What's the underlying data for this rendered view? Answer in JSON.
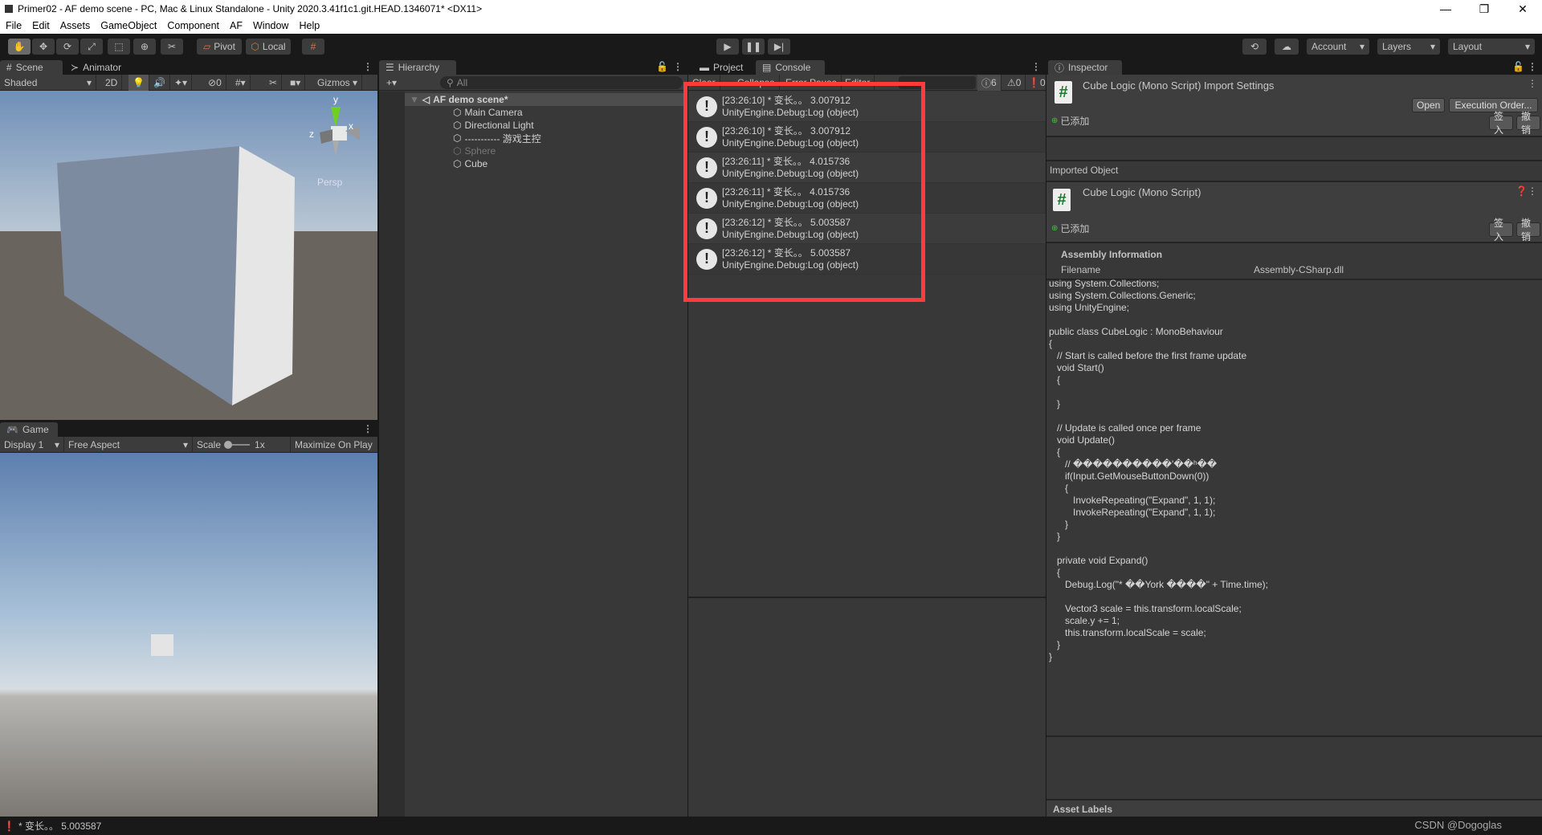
{
  "window": {
    "title": "Primer02 - AF demo scene - PC, Mac & Linux Standalone - Unity 2020.3.41f1c1.git.HEAD.1346071* <DX11>",
    "minimize": "—",
    "restore": "❐",
    "close": "✕"
  },
  "menu": [
    "File",
    "Edit",
    "Assets",
    "GameObject",
    "Component",
    "AF",
    "Window",
    "Help"
  ],
  "toolbar": {
    "tools": [
      "hand-tool",
      "move-tool",
      "rotate-tool",
      "scale-tool",
      "rect-tool",
      "transform-tool",
      "custom-tool"
    ],
    "pivot": "Pivot",
    "local": "Local",
    "account": "Account",
    "layers": "Layers",
    "layout": "Layout"
  },
  "scene": {
    "tabs": [
      "Scene",
      "Animator"
    ],
    "shading": "Shaded",
    "mode2d": "2D",
    "hidden_count": "0",
    "gizmos": "Gizmos",
    "persp": "Persp",
    "axes": {
      "x": "x",
      "y": "y",
      "z": "z"
    }
  },
  "game": {
    "tab": "Game",
    "display": "Display 1",
    "aspect": "Free Aspect",
    "scale_label": "Scale",
    "scale_value": "1x",
    "maximize": "Maximize On Play"
  },
  "hierarchy": {
    "tab": "Hierarchy",
    "search_placeholder": "All",
    "scene": "AF demo scene*",
    "items": [
      "Main Camera",
      "Directional Light",
      "----------- 游戏主控",
      "Sphere",
      "Cube"
    ]
  },
  "console": {
    "tabs": [
      "Project",
      "Console"
    ],
    "buttons": [
      "Clear",
      "Collapse",
      "Error Pause",
      "Editor"
    ],
    "counts": {
      "log": "6",
      "warn": "0",
      "error": "0"
    },
    "entries": [
      {
        "line1": "[23:26:10] * 变长。。 3.007912",
        "line2": "UnityEngine.Debug:Log (object)"
      },
      {
        "line1": "[23:26:10] * 变长。。 3.007912",
        "line2": "UnityEngine.Debug:Log (object)"
      },
      {
        "line1": "[23:26:11] * 变长。。 4.015736",
        "line2": "UnityEngine.Debug:Log (object)"
      },
      {
        "line1": "[23:26:11] * 变长。。 4.015736",
        "line2": "UnityEngine.Debug:Log (object)"
      },
      {
        "line1": "[23:26:12] * 变长。。 5.003587",
        "line2": "UnityEngine.Debug:Log (object)"
      },
      {
        "line1": "[23:26:12] * 变长。。 5.003587",
        "line2": "UnityEngine.Debug:Log (object)"
      }
    ],
    "highlight_color": "#ff3b3b"
  },
  "inspector": {
    "tab": "Inspector",
    "title": "Cube Logic (Mono Script) Import Settings",
    "open": "Open",
    "exec_order": "Execution Order...",
    "vcs_status": "已添加",
    "checkin": "签入",
    "revert": "撤销",
    "imported_object": "Imported Object",
    "object_title": "Cube Logic (Mono Script)",
    "assembly_info": "Assembly Information",
    "filename_label": "Filename",
    "filename_value": "Assembly-CSharp.dll",
    "code": "using System.Collections;\nusing System.Collections.Generic;\nusing UnityEngine;\n\npublic class CubeLogic : MonoBehaviour\n{\n   // Start is called before the first frame update\n   void Start()\n   {\n\n   }\n\n   // Update is called once per frame\n   void Update()\n   {\n      // ����������'��ʰ��\n      if(Input.GetMouseButtonDown(0))\n      {\n         InvokeRepeating(\"Expand\", 1, 1);\n         InvokeRepeating(\"Expand\", 1, 1);\n      }\n   }\n\n   private void Expand()\n   {\n      Debug.Log(\"* ��York ����\" + Time.time);\n\n      Vector3 scale = this.transform.localScale;\n      scale.y += 1;\n      this.transform.localScale = scale;\n   }\n}",
    "asset_labels": "Asset Labels"
  },
  "status": {
    "message": "* 变长。。 5.003587",
    "watermark": "CSDN @Dogoglas"
  }
}
